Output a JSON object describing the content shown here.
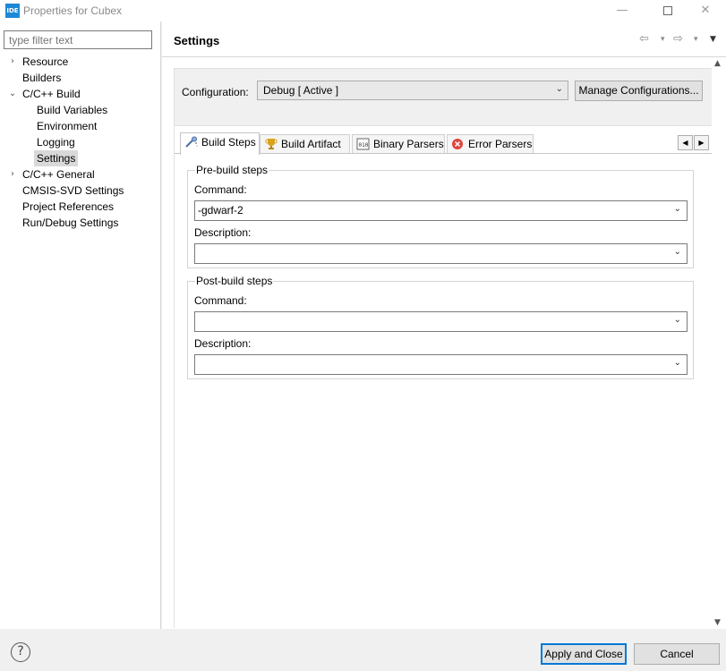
{
  "window": {
    "app_icon_text": "IDE",
    "title": "Properties for Cubex",
    "minimize": "—",
    "close": "✕"
  },
  "left": {
    "filter_placeholder": "type filter text",
    "tree": [
      {
        "label": "Resource",
        "level": 0,
        "chevron": "›"
      },
      {
        "label": "Builders",
        "level": 0,
        "chevron": ""
      },
      {
        "label": "C/C++ Build",
        "level": 0,
        "chevron": "⌄"
      },
      {
        "label": "Build Variables",
        "level": 1,
        "chevron": ""
      },
      {
        "label": "Environment",
        "level": 1,
        "chevron": ""
      },
      {
        "label": "Logging",
        "level": 1,
        "chevron": ""
      },
      {
        "label": "Settings",
        "level": 1,
        "chevron": "",
        "selected": true
      },
      {
        "label": "C/C++ General",
        "level": 0,
        "chevron": "›"
      },
      {
        "label": "CMSIS-SVD Settings",
        "level": 0,
        "chevron": ""
      },
      {
        "label": "Project References",
        "level": 0,
        "chevron": ""
      },
      {
        "label": "Run/Debug Settings",
        "level": 0,
        "chevron": ""
      }
    ]
  },
  "header": {
    "title": "Settings",
    "back_icon": "⇦",
    "forward_icon": "⇨",
    "dropdown_glyph": "▾",
    "view_menu_glyph": "▼"
  },
  "config": {
    "label": "Configuration:",
    "value": "Debug  [ Active ]",
    "manage_button": "Manage Configurations..."
  },
  "tabs": [
    {
      "label": "Build Steps",
      "icon": "build-steps-icon",
      "active": true
    },
    {
      "label": "Build Artifact",
      "icon": "trophy-icon",
      "active": false
    },
    {
      "label": "Binary Parsers",
      "icon": "binary-icon",
      "active": false
    },
    {
      "label": "Error Parsers",
      "icon": "error-icon",
      "active": false
    }
  ],
  "tab_scroll": {
    "left": "◀",
    "right": "▶"
  },
  "prebuild": {
    "title": "Pre-build steps",
    "command_label": "Command:",
    "command_value": "-gdwarf-2",
    "description_label": "Description:",
    "description_value": ""
  },
  "postbuild": {
    "title": "Post-build steps",
    "command_label": "Command:",
    "command_value": "",
    "description_label": "Description:",
    "description_value": ""
  },
  "footer": {
    "help_glyph": "?",
    "apply_close": "Apply and Close",
    "cancel": "Cancel"
  },
  "colors": {
    "accent": "#0078d7",
    "app_icon": "#1e88d6",
    "error_icon": "#e0443e",
    "trophy_icon": "#d9a21b"
  }
}
